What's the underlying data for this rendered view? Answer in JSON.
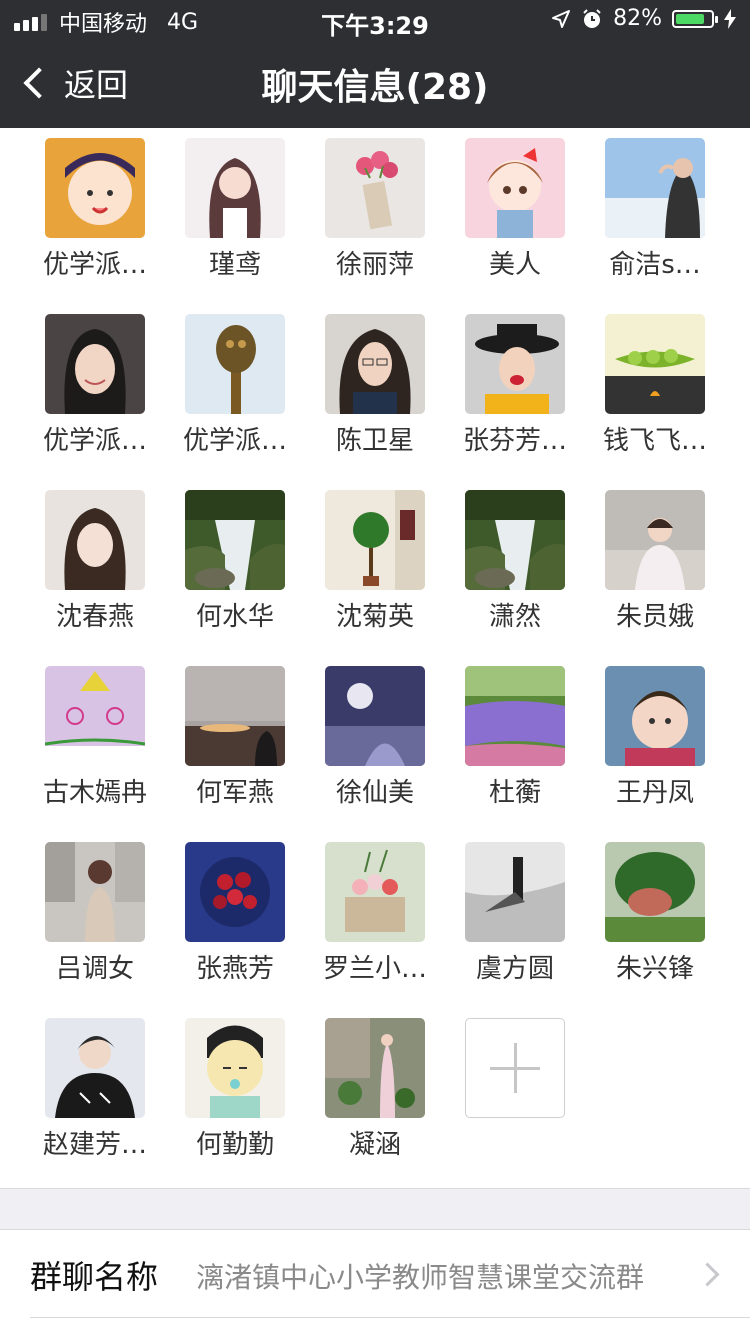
{
  "status_bar": {
    "carrier": "中国移动",
    "network": "4G",
    "time": "下午3:29",
    "battery": "82%",
    "battery_level": 0.82,
    "battery_color": "#4cd964"
  },
  "nav": {
    "back_label": "返回",
    "title": "聊天信息(28)"
  },
  "members": [
    {
      "name": "优学派…"
    },
    {
      "name": "瑾鸢"
    },
    {
      "name": "徐丽萍"
    },
    {
      "name": "美人"
    },
    {
      "name": "俞洁s…"
    },
    {
      "name": "优学派…"
    },
    {
      "name": "优学派…"
    },
    {
      "name": "陈卫星"
    },
    {
      "name": "张芬芳…"
    },
    {
      "name": "钱飞飞…"
    },
    {
      "name": "沈春燕"
    },
    {
      "name": "何水华"
    },
    {
      "name": "沈菊英"
    },
    {
      "name": "潇然"
    },
    {
      "name": "朱员娥"
    },
    {
      "name": "古木嫣冉"
    },
    {
      "name": "何军燕"
    },
    {
      "name": "徐仙美"
    },
    {
      "name": "杜蘅"
    },
    {
      "name": "王丹凤"
    },
    {
      "name": "吕调女"
    },
    {
      "name": "张燕芳"
    },
    {
      "name": "罗兰小…"
    },
    {
      "name": "虞方圆"
    },
    {
      "name": "朱兴锋"
    },
    {
      "name": "赵建芳…"
    },
    {
      "name": "何勤勤"
    },
    {
      "name": "凝涵"
    }
  ],
  "add_member_icon": "plus-icon",
  "group_settings": {
    "name_label": "群聊名称",
    "name_value": "漓渚镇中心小学教师智慧课堂交流群"
  },
  "colors": {
    "nav_background": "#2e2f33",
    "section_background": "#efeff4"
  }
}
